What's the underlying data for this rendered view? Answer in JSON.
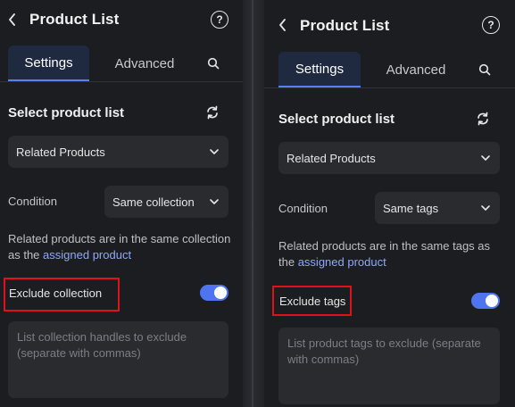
{
  "left": {
    "title": "Product List",
    "tabs": {
      "settings": "Settings",
      "advanced": "Advanced"
    },
    "section_title": "Select product list",
    "list_select": "Related Products",
    "condition_label": "Condition",
    "condition_value": "Same collection",
    "description": "Related products are in the same collection as the",
    "description_link": "assigned product",
    "toggle_label": "Exclude collection",
    "toggle_on": true,
    "textarea_placeholder": "List collection handles to exclude (separate with commas)"
  },
  "right": {
    "title": "Product List",
    "tabs": {
      "settings": "Settings",
      "advanced": "Advanced"
    },
    "section_title": "Select product list",
    "list_select": "Related Products",
    "condition_label": "Condition",
    "condition_value": "Same tags",
    "description": "Related products are in the same tags as the",
    "description_link": "assigned product",
    "toggle_label": "Exclude tags",
    "toggle_on": true,
    "textarea_placeholder": "List product tags to exclude (separate with commas)"
  },
  "icons": {
    "back": "chevron-left-icon",
    "help": "question-circle-icon",
    "search": "search-icon",
    "refresh": "refresh-icon",
    "dropdown": "chevron-down-icon"
  },
  "colors": {
    "panel_bg": "#1c1d20",
    "input_bg": "#2a2b2f",
    "accent": "#4f74f0",
    "link": "#8fa6ff",
    "highlight": "#e0111b"
  }
}
